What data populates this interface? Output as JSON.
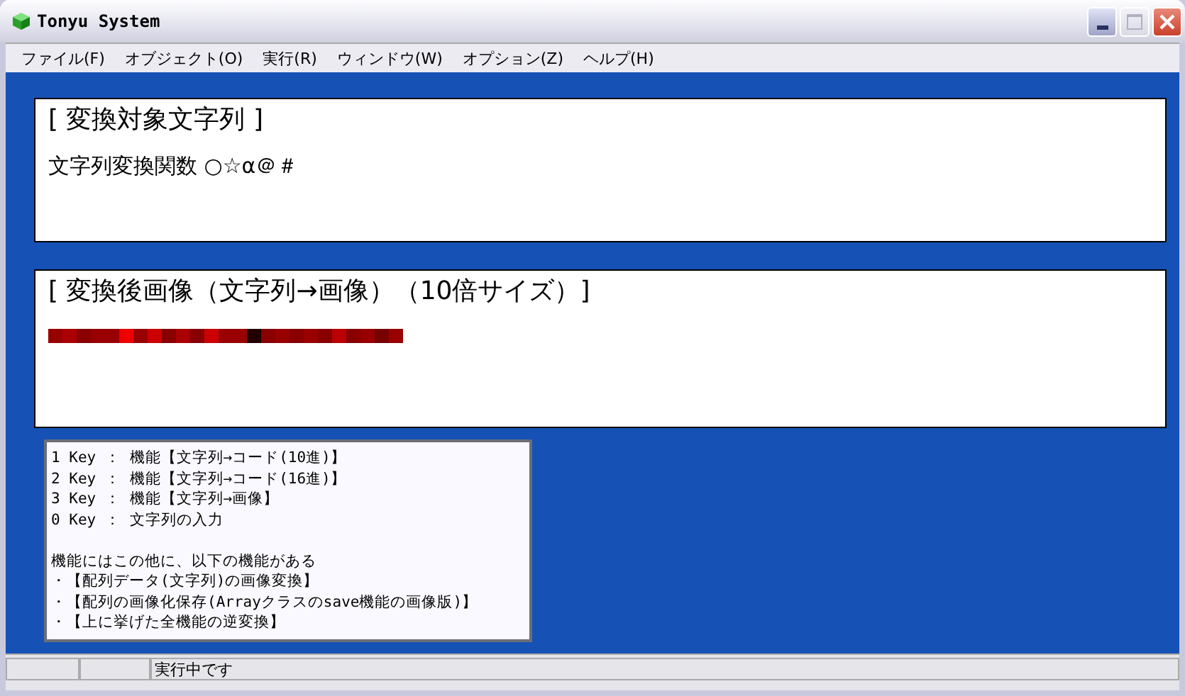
{
  "window": {
    "title": "Tonyu System"
  },
  "menu": [
    {
      "label": "ファイル(F)"
    },
    {
      "label": "オブジェクト(O)"
    },
    {
      "label": "実行(R)"
    },
    {
      "label": "ウィンドウ(W)"
    },
    {
      "label": "オプション(Z)"
    },
    {
      "label": "ヘルプ(H)"
    }
  ],
  "source_panel": {
    "heading": "[ 変換対象文字列 ]",
    "text": "文字列変換関数 ○☆α＠＃"
  },
  "result_panel": {
    "heading": "[ 変換後画像（文字列→画像）（10倍サイズ）]",
    "pixels": [
      {
        "color": "#990000"
      },
      {
        "color": "#aa0000"
      },
      {
        "color": "#880000"
      },
      {
        "color": "#990000"
      },
      {
        "color": "#990000"
      },
      {
        "color": "#ee0000"
      },
      {
        "color": "#990000"
      },
      {
        "color": "#cc0000"
      },
      {
        "color": "#880000"
      },
      {
        "color": "#aa0000"
      },
      {
        "color": "#880000"
      },
      {
        "color": "#cc0000"
      },
      {
        "color": "#990000"
      },
      {
        "color": "#990000"
      },
      {
        "color": "#220000"
      },
      {
        "color": "#880000"
      },
      {
        "color": "#990000"
      },
      {
        "color": "#880000"
      },
      {
        "color": "#990000"
      },
      {
        "color": "#880000"
      },
      {
        "color": "#bb0000"
      },
      {
        "color": "#880000"
      },
      {
        "color": "#990000"
      },
      {
        "color": "#770000"
      },
      {
        "color": "#990000"
      }
    ]
  },
  "help": {
    "lines": [
      "1 Key ： 機能【文字列→コード(10進)】",
      "2 Key ： 機能【文字列→コード(16進)】",
      "3 Key ： 機能【文字列→画像】",
      "0 Key ： 文字列の入力"
    ],
    "notes": [
      "機能にはこの他に、以下の機能がある",
      "・【配列データ(文字列)の画像変換】",
      "・【配列の画像化保存(Arrayクラスのsave機能の画像版)】",
      "・【上に挙げた全機能の逆変換】"
    ]
  },
  "status_bar": {
    "text": "実行中です"
  }
}
